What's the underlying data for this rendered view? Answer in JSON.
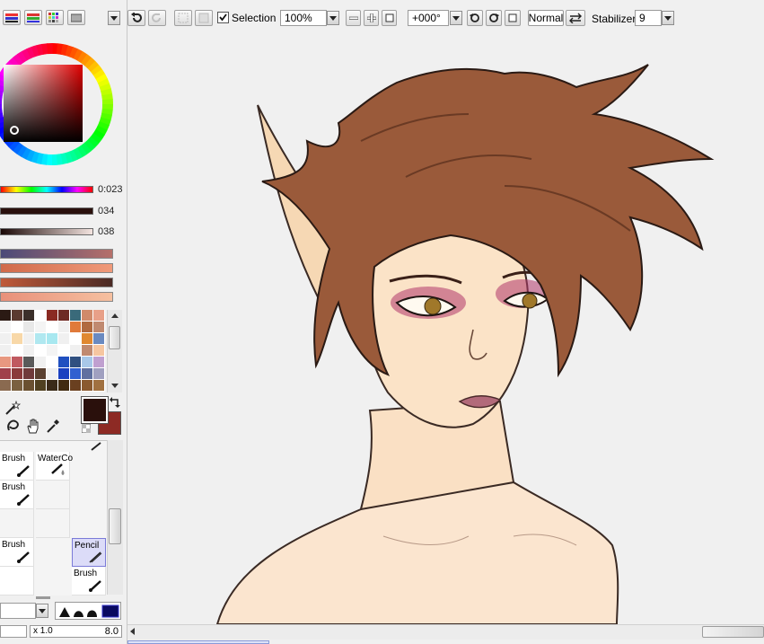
{
  "toolbar": {
    "selection_label": "Selection",
    "selection_checked": true,
    "zoom_value": "100%",
    "rotation_value": "+000°",
    "blend_mode": "Normal",
    "stabilizer_label": "Stabilizer",
    "stabilizer_value": "9"
  },
  "color_panel": {
    "slider_values": [
      "0:023",
      "034",
      "038"
    ],
    "main_color": "#2a100c",
    "sub_color": "#8d2a24",
    "palette": [
      "#2b1a14",
      "#5a3a30",
      "#3b2f2a",
      "#ffffff",
      "#8a2a22",
      "#6e2a24",
      "#3a6a7a",
      "#d08a6a",
      "#e8a088",
      "#f4f4f4",
      "#ffffff",
      "#e8e8e8",
      "#f4f4f4",
      "#ffffff",
      "#f0f0f0",
      "#e07a3a",
      "#b06a40",
      "#c08a70",
      "#f0f0f0",
      "#f8d8a8",
      "#f0f0f0",
      "#b0e8f0",
      "#a8e8f0",
      "#f0f0f0",
      "#ffffff",
      "#e08830",
      "#6a8ac0",
      "#f0f0f0",
      "#ffffff",
      "#f0f0f0",
      "#ffffff",
      "#f4f4f4",
      "#ffffff",
      "#f0f0f0",
      "#c08a70",
      "#f6c6a0",
      "#e89880",
      "#c05a60",
      "#5a5a5a",
      "#f0f0f0",
      "#ffffff",
      "#2050c0",
      "#305080",
      "#a8c8e8",
      "#c0a0d0",
      "#a0404a",
      "#8a3a3a",
      "#703a3a",
      "#5a4030",
      "#f0f0f0",
      "#1a40c0",
      "#3060d0",
      "#6070a0",
      "#a0a0c0",
      "#8a6a50",
      "#7a6040",
      "#6a5030",
      "#504020",
      "#3a2a18",
      "#402a10",
      "#6a4020",
      "#8a5a30",
      "#a07040"
    ]
  },
  "tools": {
    "rows": [
      [
        {
          "label": "Brush",
          "selected": false
        },
        {
          "label": "WaterCo",
          "selected": false
        }
      ],
      [
        {
          "label": "Brush",
          "selected": false
        },
        {
          "label": "",
          "selected": false
        }
      ],
      [
        {
          "label": "",
          "selected": false
        },
        {
          "label": "",
          "selected": false
        }
      ],
      [
        {
          "label": "Brush",
          "selected": false
        },
        {
          "label": "Pencil",
          "selected": true
        }
      ],
      [
        {
          "label": "",
          "selected": false
        },
        {
          "label": "Brush",
          "selected": false
        }
      ]
    ]
  },
  "brush_settings": {
    "size_multiplier": "x 1.0",
    "size_value": "8.0"
  }
}
